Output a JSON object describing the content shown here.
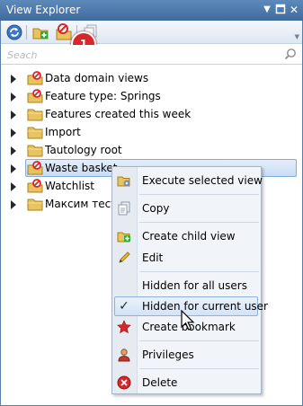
{
  "window": {
    "title": "View Explorer"
  },
  "toolbar": {
    "buttons": [
      {
        "icon": "refresh-icon"
      },
      {
        "icon": "add-folder-icon"
      },
      {
        "icon": "no-entry-folder-icon"
      },
      {
        "icon": "copy-icon"
      }
    ],
    "callout_number": "1"
  },
  "search": {
    "placeholder": "Seach",
    "value": ""
  },
  "tree": {
    "items": [
      {
        "label": "Data domain views",
        "icon": "no-entry-folder-icon"
      },
      {
        "label": "Feature type: Springs",
        "icon": "no-entry-folder-icon"
      },
      {
        "label": "Features created this week",
        "icon": "folder-icon"
      },
      {
        "label": "Import",
        "icon": "folder-icon"
      },
      {
        "label": "Tautology root",
        "icon": "folder-icon"
      },
      {
        "label": "Waste basket",
        "icon": "no-entry-folder-icon",
        "selected": true
      },
      {
        "label": "Watchlist",
        "icon": "no-entry-folder-icon"
      },
      {
        "label": "Максим тести",
        "icon": "folder-icon"
      }
    ]
  },
  "context_menu": {
    "items": [
      {
        "label": "Execute selected view",
        "icon": "execute-view-icon"
      },
      {
        "label": "Copy",
        "icon": "copy-icon"
      },
      {
        "label": "Create child view",
        "icon": "add-folder-icon"
      },
      {
        "label": "Edit",
        "icon": "pencil-icon"
      },
      {
        "label": "Hidden for all users",
        "icon": ""
      },
      {
        "label": "Hidden for current user",
        "icon": "checkmark-icon",
        "checked": true,
        "highlighted": true
      },
      {
        "label": "Create bookmark",
        "icon": "star-icon"
      },
      {
        "label": "Privileges",
        "icon": "user-icon"
      },
      {
        "label": "Delete",
        "icon": "delete-icon"
      }
    ],
    "checkmark_glyph": "✓"
  },
  "colors": {
    "title_bar": "#3e6a9e",
    "selection": "#c9dcf4",
    "callout": "#d9262a",
    "folder": "#e9c45c",
    "no_entry": "#d8262a"
  }
}
